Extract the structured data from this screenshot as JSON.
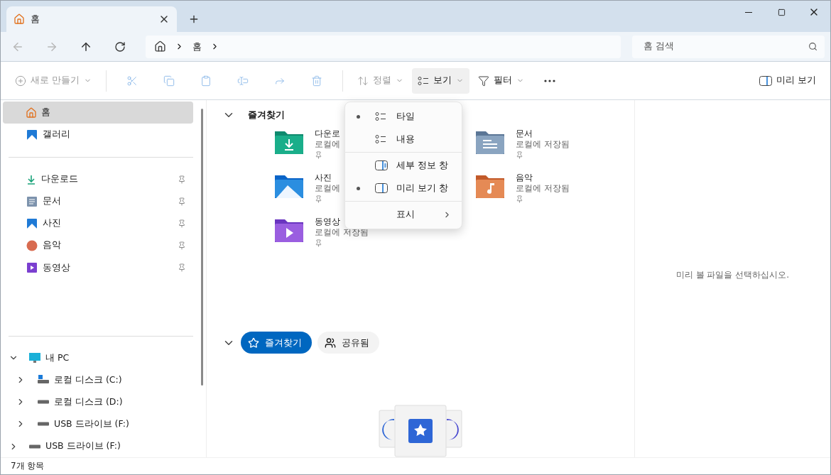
{
  "tab": {
    "title": "홈",
    "selected": true
  },
  "address": {
    "crumbs": [
      "홈"
    ]
  },
  "search": {
    "placeholder": "홈 검색"
  },
  "toolbar": {
    "groups": [
      [
        {
          "kind": "new",
          "label": "새로 만들기",
          "disabled": true
        }
      ],
      [
        {
          "kind": "cut",
          "disabled": true
        },
        {
          "kind": "copy",
          "disabled": true
        },
        {
          "kind": "paste",
          "disabled": true
        },
        {
          "kind": "rename",
          "disabled": true
        },
        {
          "kind": "share",
          "disabled": true
        },
        {
          "kind": "delete",
          "disabled": true
        }
      ],
      [
        {
          "kind": "sort",
          "label": "정렬",
          "disabled": true
        },
        {
          "kind": "view",
          "label": "보기",
          "disabled": false,
          "pressed": true
        },
        {
          "kind": "filter",
          "label": "필터",
          "disabled": false,
          "pressed": false
        }
      ],
      [
        {
          "kind": "more",
          "disabled": false
        }
      ]
    ],
    "preview_button": "미리 보기"
  },
  "sidebar": {
    "top": [
      {
        "kind": "home",
        "label": "홈",
        "selected": true
      },
      {
        "kind": "gallery",
        "label": "갤러리",
        "selected": false
      }
    ],
    "quick": [
      {
        "kind": "download",
        "label": "다운로드",
        "pinned": true,
        "selected": false
      },
      {
        "kind": "documents",
        "label": "문서",
        "pinned": true,
        "selected": false
      },
      {
        "kind": "pictures",
        "label": "사진",
        "pinned": true,
        "selected": false
      },
      {
        "kind": "music",
        "label": "음악",
        "pinned": true,
        "selected": false
      },
      {
        "kind": "videos",
        "label": "동영상",
        "pinned": true,
        "selected": false
      }
    ],
    "tree": [
      {
        "kind": "pc",
        "label": "내 PC",
        "expanded": true,
        "children": [
          {
            "kind": "system",
            "label": "로컬 디스크 (C:)",
            "expanded": false
          },
          {
            "kind": "drive",
            "label": "로컬 디스크 (D:)",
            "expanded": false
          },
          {
            "kind": "drive",
            "label": "USB 드라이브 (F:)",
            "expanded": false
          }
        ]
      },
      {
        "kind": "drive",
        "label": "USB 드라이브 (F:)",
        "expanded": false
      }
    ]
  },
  "quick_access": {
    "title": "즐겨찾기",
    "expanded": true,
    "folders": [
      {
        "kind": "download",
        "name": "다운로",
        "subtitle": "로컬에",
        "pinned": true
      },
      {
        "kind": "documents",
        "name": "문서",
        "subtitle": "로컬에 저장됨",
        "pinned": true
      },
      {
        "kind": "pictures",
        "name": "사진",
        "subtitle": "로컬에",
        "pinned": true
      },
      {
        "kind": "music",
        "name": "음악",
        "subtitle": "로컬에 저장됨",
        "pinned": true
      },
      {
        "kind": "videos",
        "name": "동영상",
        "subtitle": "로컬에 저장됨",
        "pinned": true
      }
    ]
  },
  "view_menu": {
    "groups": [
      [
        {
          "kind": "tiles",
          "label": "타일",
          "selected": true
        },
        {
          "kind": "content",
          "label": "내용",
          "selected": false
        }
      ],
      [
        {
          "kind": "details",
          "label": "세부 정보 창",
          "selected": false
        },
        {
          "kind": "preview",
          "label": "미리 보기 창",
          "selected": true
        }
      ],
      [
        {
          "kind": "submenu",
          "label": "표시"
        }
      ]
    ]
  },
  "files_section": {
    "expanded": true,
    "tabs": [
      {
        "kind": "favorites",
        "label": "즐겨찾기",
        "selected": true
      },
      {
        "kind": "shared",
        "label": "공유됨",
        "selected": false
      }
    ]
  },
  "preview_pane": {
    "message": "미리 볼 파일을 선택하십시오."
  },
  "status_bar": "7개 항목"
}
